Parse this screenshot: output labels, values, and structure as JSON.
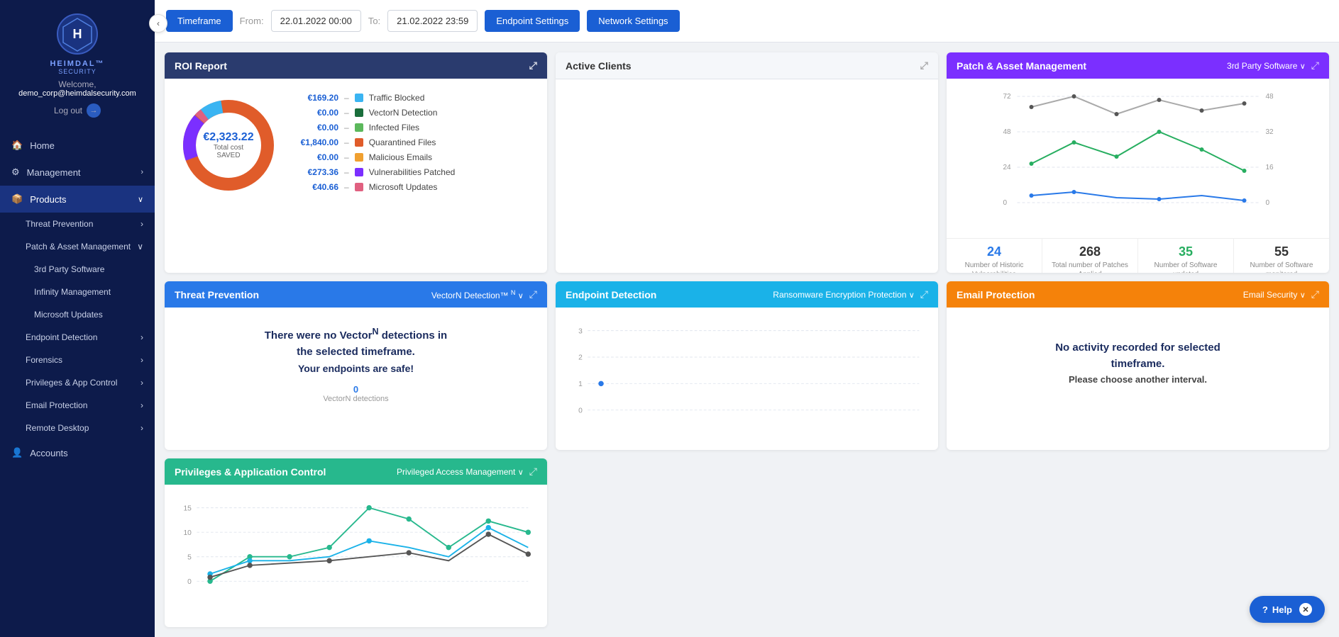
{
  "app": {
    "title": "Heimdal Security"
  },
  "sidebar": {
    "welcome_text": "Welcome,",
    "user_email": "demo_corp@heimdalsecurity.com",
    "logout_label": "Log out",
    "collapse_icon": "‹",
    "nav_items": [
      {
        "id": "home",
        "label": "Home",
        "icon": "🏠",
        "active": false
      },
      {
        "id": "management",
        "label": "Management",
        "icon": "⚙",
        "has_arrow": true,
        "active": false
      },
      {
        "id": "products",
        "label": "Products",
        "icon": "📦",
        "has_arrow": true,
        "active": true
      },
      {
        "id": "threat-prevention",
        "label": "Threat Prevention",
        "sub": true,
        "has_arrow": true,
        "active": false
      },
      {
        "id": "patch-asset",
        "label": "Patch & Asset Management",
        "sub": true,
        "has_arrow": true,
        "active": false
      },
      {
        "id": "3rd-party",
        "label": "3rd Party Software",
        "sub2": true,
        "active": false
      },
      {
        "id": "infinity",
        "label": "Infinity Management",
        "sub2": true,
        "active": false
      },
      {
        "id": "microsoft-updates",
        "label": "Microsoft Updates",
        "sub2": true,
        "active": false
      },
      {
        "id": "endpoint-detection",
        "label": "Endpoint Detection",
        "sub": true,
        "has_arrow": true,
        "active": false
      },
      {
        "id": "forensics",
        "label": "Forensics",
        "sub": true,
        "has_arrow": true,
        "active": false
      },
      {
        "id": "privileges",
        "label": "Privileges & App Control",
        "sub": true,
        "has_arrow": true,
        "active": false
      },
      {
        "id": "email-protection",
        "label": "Email Protection",
        "sub": true,
        "has_arrow": true,
        "active": false
      },
      {
        "id": "remote-desktop",
        "label": "Remote Desktop",
        "sub": true,
        "has_arrow": true,
        "active": false
      },
      {
        "id": "accounts",
        "label": "Accounts",
        "icon": "👤",
        "active": false
      }
    ]
  },
  "toolbar": {
    "timeframe_label": "Timeframe",
    "from_label": "From:",
    "from_value": "22.01.2022 00:00",
    "to_label": "To:",
    "to_value": "21.02.2022 23:59",
    "endpoint_settings_label": "Endpoint Settings",
    "network_settings_label": "Network Settings"
  },
  "roi_card": {
    "title": "ROI Report",
    "amount": "€2,323.22",
    "subtitle": "Total cost SAVED",
    "rows": [
      {
        "amount": "€169.20",
        "color": "#3ab4f2",
        "label": "Traffic Blocked"
      },
      {
        "amount": "€0.00",
        "color": "#1a6e3c",
        "label": "VectorN Detection"
      },
      {
        "amount": "€0.00",
        "color": "#5cb85c",
        "label": "Infected Files"
      },
      {
        "amount": "€1,840.00",
        "color": "#e05c2a",
        "label": "Quarantined Files"
      },
      {
        "amount": "€0.00",
        "color": "#f0a030",
        "label": "Malicious Emails"
      },
      {
        "amount": "€273.36",
        "color": "#7b2fff",
        "label": "Vulnerabilities Patched"
      },
      {
        "amount": "€40.66",
        "color": "#e06080",
        "label": "Microsoft Updates"
      }
    ]
  },
  "active_clients_card": {
    "title": "Active Clients"
  },
  "threat_card": {
    "title": "Threat Prevention",
    "dropdown": "VectorN Detection™",
    "message_line1": "There were no Vector",
    "message_sup": "N",
    "message_line2": " detections in",
    "message_line3": "the selected timeframe.",
    "safe_message": "Your endpoints are safe!",
    "count": "0",
    "count_label": "VectorN detections"
  },
  "patch_card": {
    "title": "Patch & Asset Management",
    "dropdown": "3rd Party Software",
    "stats": [
      {
        "val": "24",
        "color": "blue",
        "label": "Number of Historic Vulnerabilities"
      },
      {
        "val": "268",
        "color": "black",
        "label": "Total number of Patches Applied"
      },
      {
        "val": "35",
        "color": "green",
        "label": "Number of Software updated"
      },
      {
        "val": "55",
        "color": "black",
        "label": "Number of Software monitored"
      }
    ],
    "chart_y_left": [
      "72",
      "48",
      "24",
      "0"
    ],
    "chart_y_right": [
      "48",
      "32",
      "16",
      "0"
    ]
  },
  "endpoint_card": {
    "title": "Endpoint Detection",
    "dropdown": "Ransomware Encryption Protection",
    "chart_y": [
      "3",
      "2",
      "1",
      "0"
    ]
  },
  "privileges_card": {
    "title": "Privileges & Application Control",
    "dropdown": "Privileged Access Management",
    "chart_y": [
      "15",
      "10",
      "5",
      "0"
    ]
  },
  "email_card": {
    "title": "Email Protection",
    "dropdown": "Email Security",
    "message_line1": "No activity recorded for selected",
    "message_line2": "timeframe.",
    "message_line3": "Please choose another interval."
  },
  "help": {
    "label": "Help",
    "close": "✕"
  }
}
